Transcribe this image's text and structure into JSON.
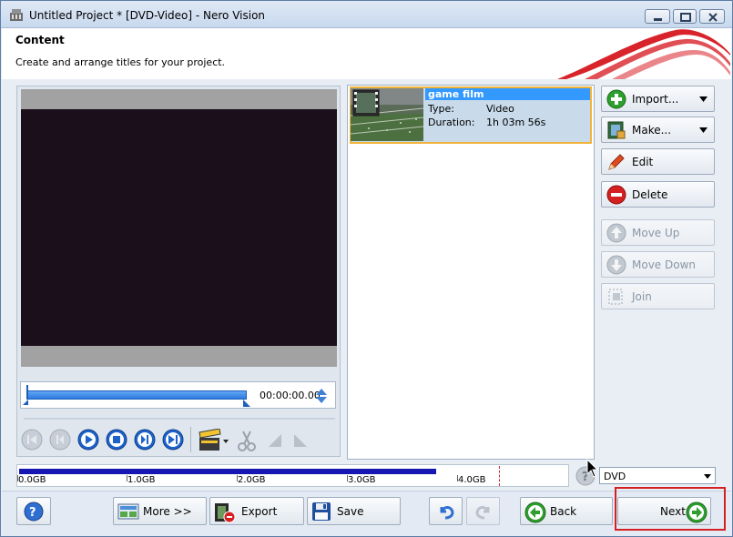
{
  "window": {
    "title": "Untitled Project * [DVD-Video] - Nero Vision"
  },
  "header": {
    "title": "Content",
    "subtitle": "Create and arrange titles for your project."
  },
  "preview": {
    "time_readout": "00:00:00.00"
  },
  "titles_list": [
    {
      "name": "game film",
      "type_label": "Type:",
      "type_value": "Video",
      "duration_label": "Duration:",
      "duration_value": "1h 03m 56s"
    }
  ],
  "side_buttons": {
    "import": "Import...",
    "make": "Make...",
    "edit": "Edit",
    "delete": "Delete",
    "move_up": "Move Up",
    "move_down": "Move Down",
    "join": "Join"
  },
  "disk": {
    "used_fraction": 0.76,
    "labels": [
      "0.0GB",
      "1.0GB",
      "2.0GB",
      "3.0GB",
      "4.0GB"
    ],
    "target": "DVD"
  },
  "bottom_buttons": {
    "more": "More >>",
    "export": "Export",
    "save": "Save",
    "back": "Back",
    "next": "Next"
  },
  "colors": {
    "accent_blue": "#3399ff",
    "selection_border": "#f0b43c",
    "disk_fill": "#1616b0",
    "highlight_red": "#d42020"
  }
}
